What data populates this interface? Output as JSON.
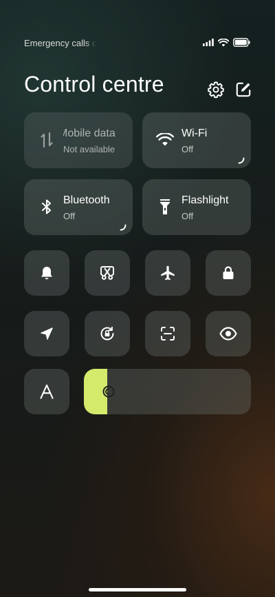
{
  "status_bar": {
    "carrier_text": "Emergency calls o",
    "signal_icon": "signal-bars-icon",
    "wifi_icon": "wifi-icon",
    "battery_icon": "battery-icon"
  },
  "header": {
    "title": "Control centre",
    "settings_icon": "gear-icon",
    "edit_icon": "edit-icon"
  },
  "tiles": [
    {
      "id": "mobile-data",
      "name": "Mobile data",
      "status": "Not available",
      "icon": "mobile-data-icon",
      "enabled": false
    },
    {
      "id": "wifi",
      "name": "Wi-Fi",
      "status": "Off",
      "icon": "wifi-icon",
      "enabled": true
    },
    {
      "id": "bluetooth",
      "name": "Bluetooth",
      "status": "Off",
      "icon": "bluetooth-icon",
      "enabled": true
    },
    {
      "id": "flashlight",
      "name": "Flashlight",
      "status": "Off",
      "icon": "flashlight-icon",
      "enabled": true
    }
  ],
  "toggles_row1": [
    "bell-icon",
    "screenshot-icon",
    "airplane-icon",
    "lock-icon"
  ],
  "toggles_row2": [
    "location-arrow-icon",
    "rotation-lock-icon",
    "scan-icon",
    "eye-icon"
  ],
  "font_size_button": {
    "label": "A",
    "icon": "font-size-icon"
  },
  "brightness": {
    "level": 0.14,
    "icon": "brightness-icon",
    "fill_color": "#d4ea6b"
  },
  "colors": {
    "tile_bg": "rgba(110,120,118,0.34)",
    "accent": "#d4ea6b"
  }
}
